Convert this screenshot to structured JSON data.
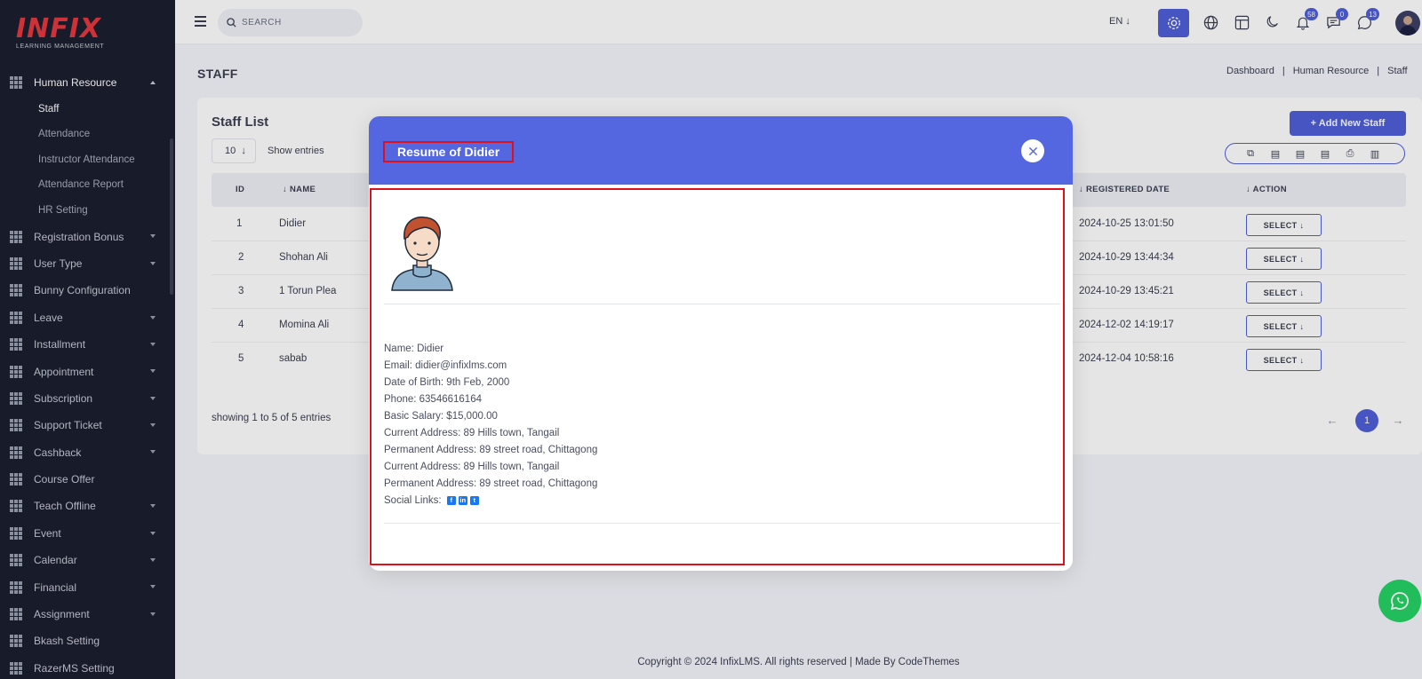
{
  "logo": {
    "brand": "INFIX",
    "tagline": "LEARNING MANAGEMENT"
  },
  "sidebar": {
    "items": [
      {
        "label": "Human Resource",
        "expanded": true
      },
      {
        "label": "Registration Bonus"
      },
      {
        "label": "User Type"
      },
      {
        "label": "Bunny Configuration"
      },
      {
        "label": "Leave"
      },
      {
        "label": "Installment"
      },
      {
        "label": "Appointment"
      },
      {
        "label": "Subscription"
      },
      {
        "label": "Support Ticket"
      },
      {
        "label": "Cashback"
      },
      {
        "label": "Course Offer"
      },
      {
        "label": "Teach Offline"
      },
      {
        "label": "Event"
      },
      {
        "label": "Calendar"
      },
      {
        "label": "Financial"
      },
      {
        "label": "Assignment"
      },
      {
        "label": "Bkash Setting"
      },
      {
        "label": "RazerMS Setting"
      }
    ],
    "subitems": [
      "Staff",
      "Attendance",
      "Instructor Attendance",
      "Attendance Report",
      "HR Setting"
    ]
  },
  "topbar": {
    "search_placeholder": "SEARCH",
    "lang": "EN",
    "badges": {
      "notifications": "58",
      "messages": "0",
      "whatsapp": "13"
    }
  },
  "page": {
    "title": "STAFF",
    "breadcrumb": [
      "Dashboard",
      "Human Resource",
      "Staff"
    ]
  },
  "card": {
    "title": "Staff List",
    "add_button": "+ Add New Staff",
    "entries_value": "10",
    "show_entries": "Show entries",
    "columns": {
      "id": "ID",
      "name": "NAME",
      "registered": "REGISTERED DATE",
      "action": "ACTION"
    },
    "rows": [
      {
        "id": "1",
        "name": "Didier",
        "date": "2024-10-25 13:01:50",
        "action": "SELECT"
      },
      {
        "id": "2",
        "name": "Shohan Ali",
        "date": "2024-10-29 13:44:34",
        "action": "SELECT"
      },
      {
        "id": "3",
        "name": "1 Torun Plea",
        "date": "2024-10-29 13:45:21",
        "action": "SELECT"
      },
      {
        "id": "4",
        "name": "Momina Ali",
        "date": "2024-12-02 14:19:17",
        "action": "SELECT"
      },
      {
        "id": "5",
        "name": "sabab",
        "date": "2024-12-04 10:58:16",
        "action": "SELECT"
      }
    ],
    "showing": "showing 1 to 5 of 5 entries",
    "current_page": "1"
  },
  "footer": "Copyright © 2024 InfixLMS. All rights reserved | Made By CodeThemes",
  "modal": {
    "title": "Resume of Didier",
    "lines": [
      "Name: Didier",
      "Email: didier@infixlms.com",
      "Date of Birth: 9th Feb, 2000",
      "Phone: 63546616164",
      "Basic Salary: $15,000.00",
      "Current Address: 89 Hills town, Tangail",
      "Permanent Address: 89 street road, Chittagong",
      "Current Address: 89 Hills town, Tangail",
      "Permanent Address: 89 street road, Chittagong"
    ],
    "social_label": "Social Links:"
  },
  "colors": {
    "accent": "#4f5fd8",
    "sidebar_bg": "#1b1f2e",
    "highlight": "#e0101b"
  }
}
